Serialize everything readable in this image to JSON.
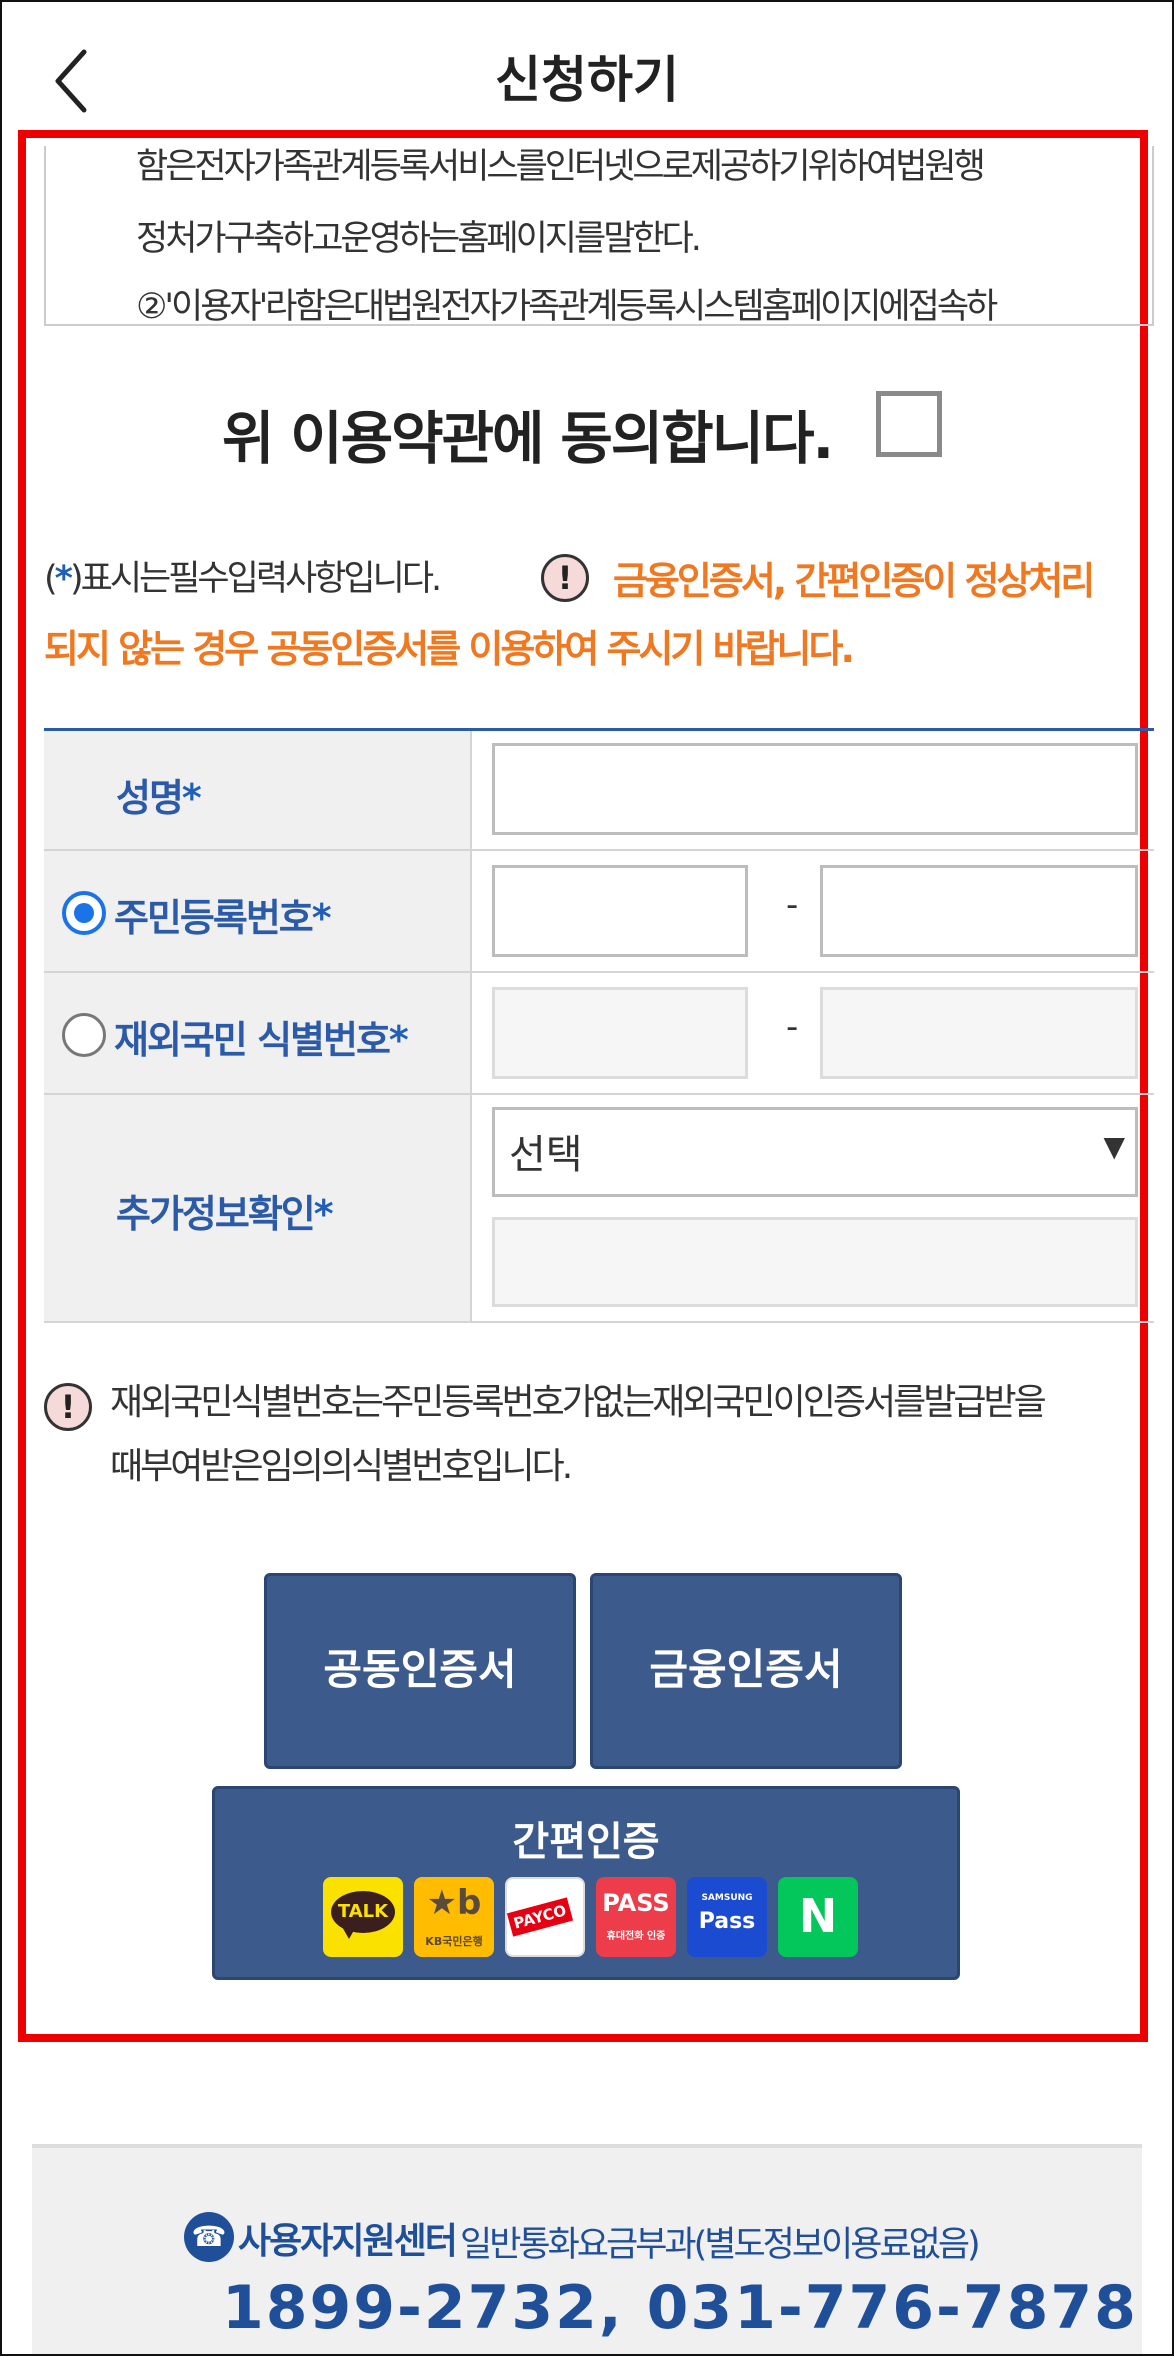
{
  "header": {
    "title": "신청하기",
    "back_icon": "chevron-left-icon"
  },
  "terms": {
    "lines": [
      "함은전자가족관계등록서비스를인터넷으로제공하기위하여법원행",
      "정처가구축하고운영하는홈페이지를말한다.",
      "②'이용자'라함은대법원전자가족관계등록시스템홈페이지에접속하"
    ]
  },
  "agree": {
    "label": "위 이용약관에 동의합니다.",
    "checked": false
  },
  "notice": {
    "required_prefix": "(",
    "required_star": "*",
    "required_suffix": ")표시는필수입력사항입니다.",
    "warning_line1": "금융인증서, 간편인증이 정상처리",
    "warning_line2": "되지 않는 경우 공동인증서를 이용하여 주시기 바랍니다."
  },
  "form": {
    "name_label": "성명",
    "rrn_label": "주민등록번호",
    "foreign_label": "재외국민 식별번호",
    "extra_label": "추가정보확인",
    "star": "*",
    "dash": "-",
    "select_value": "선택",
    "select_arrow": "▼",
    "selected_option": "rrn"
  },
  "note": {
    "line1": "재외국민식별번호는주민등록번호가없는재외국민이인증서를발급받을",
    "line2": "때부여받은임의의식별번호입니다."
  },
  "buttons": {
    "joint_cert": "공동인증서",
    "financial_cert": "금융인증서",
    "easy_auth": "간편인증"
  },
  "easy_logos": {
    "kakao": "TALK",
    "kb_symbol": "★b",
    "kb_name": "KB국민은행",
    "payco": "PAYCO",
    "pass_main": "PASS",
    "pass_sub": "휴대전화 인증",
    "samsung_brand": "SAMSUNG",
    "samsung_pass": "Pass",
    "naver": "N"
  },
  "footer": {
    "title": "사용자지원센터",
    "subtitle": "일반통화요금부과(별도정보이용료없음)",
    "numbers": "1899-2732, 031-776-7878"
  },
  "colors": {
    "accent_blue": "#2b5aa8",
    "button_blue": "#3c5a8c",
    "warning_orange": "#f07820",
    "highlight_red": "#ee0000"
  }
}
